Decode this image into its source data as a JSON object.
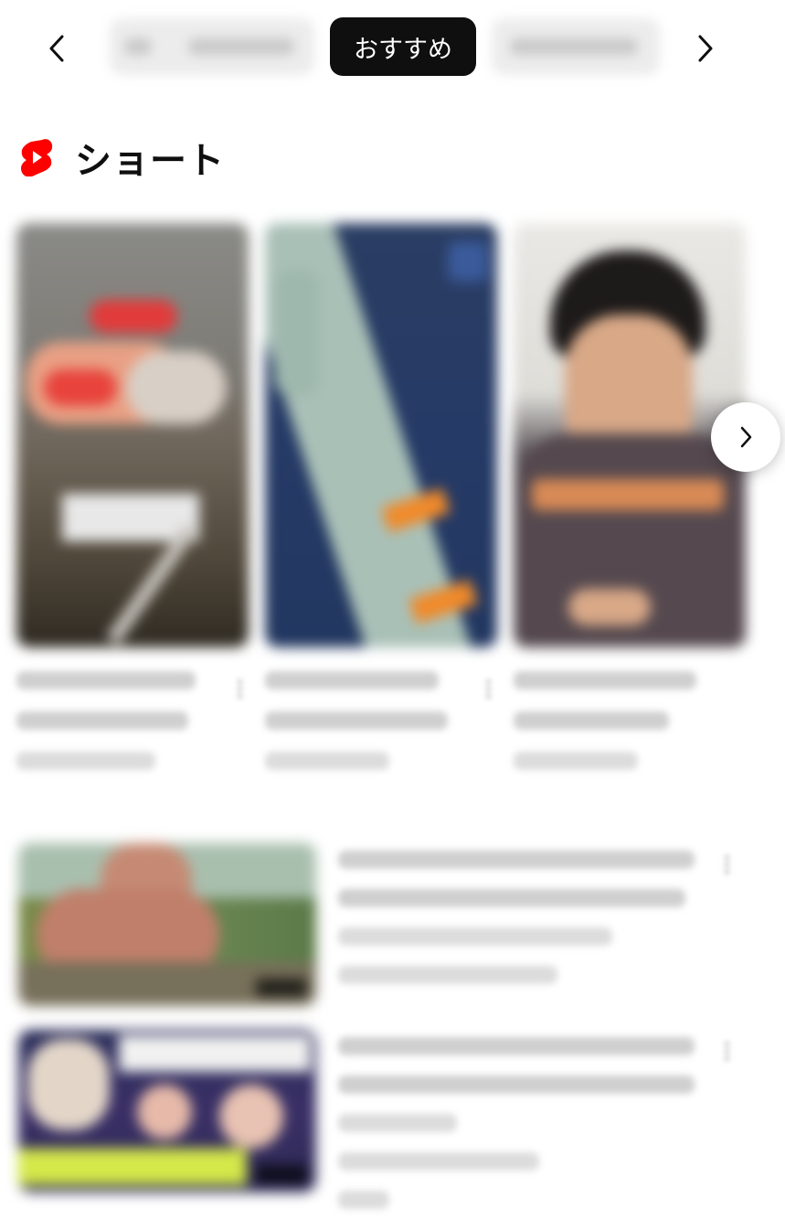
{
  "chipbar": {
    "active_chip": "おすすめ",
    "prev_icon": "chevron-left-icon",
    "next_icon": "chevron-right-icon"
  },
  "shorts": {
    "section_title": "ショート",
    "logo_icon": "youtube-shorts-icon",
    "logo_color": "#ff0000",
    "next_icon": "chevron-right-icon"
  },
  "colors": {
    "active_chip_bg": "#0f0f0f",
    "active_chip_text": "#ffffff"
  }
}
